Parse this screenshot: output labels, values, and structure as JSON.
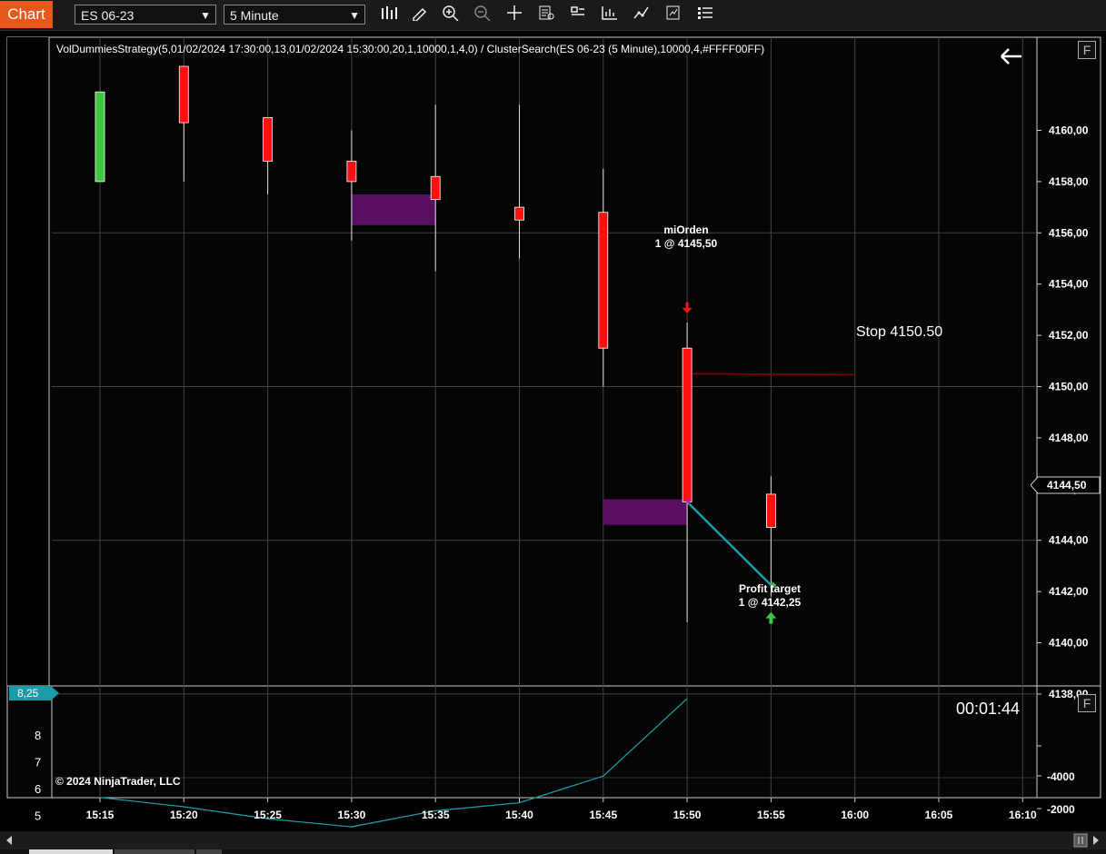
{
  "toolbar": {
    "chart_tab": "Chart",
    "instrument": "ES 06-23",
    "interval": "5 Minute",
    "tools": [
      "bar-type-icon",
      "pencil-icon",
      "zoom-in-icon",
      "zoom-out-icon",
      "crosshair-icon",
      "data-box-icon",
      "properties-icon",
      "chart-trader-icon",
      "indicators-icon",
      "strategies-icon",
      "object-list-icon"
    ]
  },
  "panel": {
    "strategy_label": "VolDummiesStrategy(5,01/02/2024 17:30:00,13,01/02/2024 15:30:00,20,1,10000,1,4,0) / ClusterSearch(ES 06-23 (5 Minute),10000,4,#FFFF00FF)",
    "f_button": "F",
    "back_arrow": "←",
    "current_price": "4144,50",
    "stop_label": "Stop 4150.50",
    "entry_name": "miOrden",
    "entry_detail": "1 @ 4145,50",
    "exit_name": "Profit target",
    "exit_detail": "1 @ 4142,25",
    "timer": "00:01:44",
    "indicator_value": "8,25",
    "copyright": "© 2024 NinjaTrader, LLC",
    "f_button_lower": "F"
  },
  "colors": {
    "up": "#3ec63e",
    "down": "#ff1010",
    "zone": "#5a1060",
    "grid": "#444444",
    "trade_line": "#1a9ba8",
    "stop_line": "#8b0000",
    "tab": "#e8571c"
  },
  "chart_data": [
    {
      "type": "candlestick",
      "instrument": "ES 06-23",
      "interval": "5 Minute",
      "x": [
        "15:15",
        "15:20",
        "15:25",
        "15:30",
        "15:35",
        "15:40",
        "15:45",
        "15:50",
        "15:55"
      ],
      "candles": [
        {
          "time": "15:15",
          "open": 4158.0,
          "high": 4161.5,
          "low": 4158.0,
          "close": 4161.5
        },
        {
          "time": "15:20",
          "open": 4162.5,
          "high": 4162.5,
          "low": 4158.0,
          "close": 4160.3
        },
        {
          "time": "15:25",
          "open": 4160.5,
          "high": 4160.5,
          "low": 4157.5,
          "close": 4158.8
        },
        {
          "time": "15:30",
          "open": 4158.8,
          "high": 4160.0,
          "low": 4155.7,
          "close": 4158.0
        },
        {
          "time": "15:35",
          "open": 4158.2,
          "high": 4161.0,
          "low": 4154.5,
          "close": 4157.3
        },
        {
          "time": "15:40",
          "open": 4157.0,
          "high": 4161.0,
          "low": 4155.0,
          "close": 4156.5
        },
        {
          "time": "15:45",
          "open": 4156.8,
          "high": 4158.5,
          "low": 4150.0,
          "close": 4151.5
        },
        {
          "time": "15:50",
          "open": 4151.5,
          "high": 4152.5,
          "low": 4140.8,
          "close": 4145.5
        },
        {
          "time": "15:55",
          "open": 4145.8,
          "high": 4146.5,
          "low": 4141.8,
          "close": 4144.5
        }
      ],
      "zones": [
        {
          "from": "15:30",
          "to": "15:35",
          "high": 4157.5,
          "low": 4156.3
        },
        {
          "from": "15:45",
          "to": "15:50",
          "high": 4145.6,
          "low": 4144.6
        }
      ],
      "trade": {
        "entry": {
          "time": "15:50",
          "price": 4145.5
        },
        "exit": {
          "time": "15:55",
          "price": 4142.25
        }
      },
      "stop": {
        "from": "15:50",
        "to": "16:00",
        "price": 4150.5
      },
      "x_ticks": [
        "15:15",
        "15:20",
        "15:25",
        "15:30",
        "15:35",
        "15:40",
        "15:45",
        "15:50",
        "15:55",
        "16:00",
        "16:05",
        "16:10"
      ],
      "y_ticks": [
        "4138,00",
        "4140,00",
        "4142,00",
        "4144,00",
        "4146,00",
        "4148,00",
        "4150,00",
        "4152,00",
        "4154,00",
        "4156,00",
        "4158,00",
        "4160,00"
      ],
      "ylim": [
        4136.5,
        4162.5
      ]
    },
    {
      "type": "line",
      "x": [
        "15:15",
        "15:20",
        "15:25",
        "15:30",
        "15:35",
        "15:40",
        "15:45",
        "15:50"
      ],
      "values": [
        5.7,
        5.35,
        4.9,
        4.6,
        5.2,
        5.5,
        6.5,
        9.4
      ],
      "left_ticks": [
        "5",
        "6",
        "7",
        "8"
      ],
      "right_ticks": [
        "-4000",
        "-2000"
      ],
      "ylim": [
        4.0,
        9.5
      ]
    }
  ]
}
